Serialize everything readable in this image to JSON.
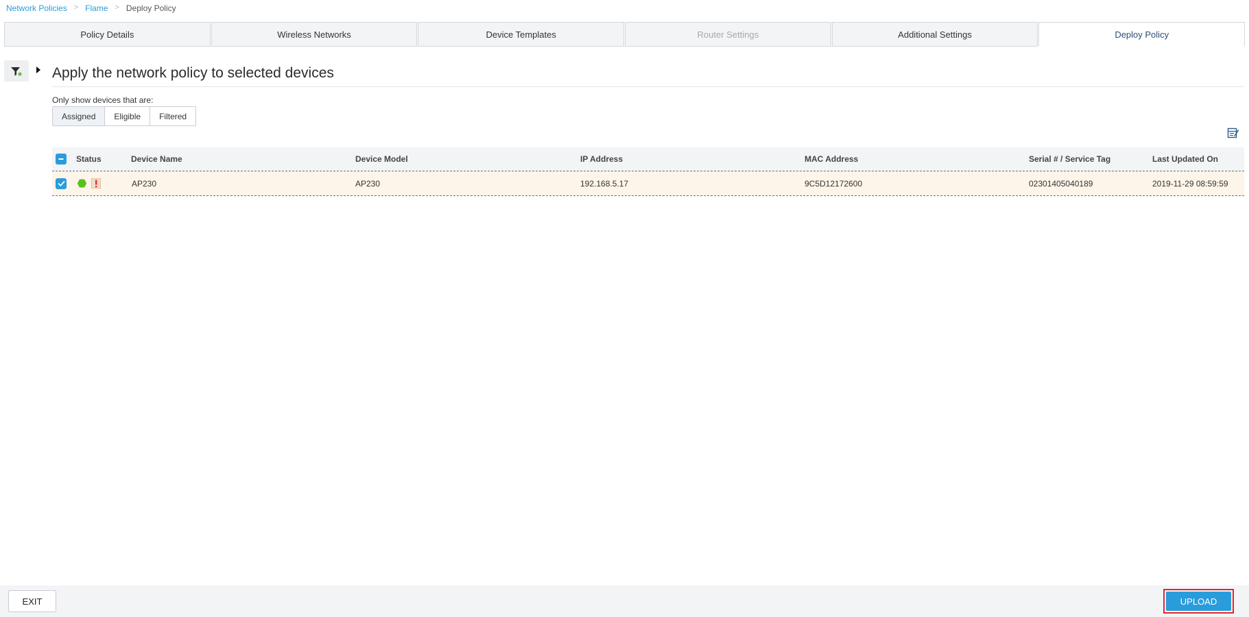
{
  "breadcrumb": {
    "items": [
      {
        "label": "Network Policies"
      },
      {
        "label": "Flame"
      },
      {
        "label": "Deploy Policy"
      }
    ],
    "separator": ">"
  },
  "tabs": [
    {
      "label": "Policy Details",
      "state": "normal"
    },
    {
      "label": "Wireless Networks",
      "state": "normal"
    },
    {
      "label": "Device Templates",
      "state": "normal"
    },
    {
      "label": "Router Settings",
      "state": "disabled"
    },
    {
      "label": "Additional Settings",
      "state": "normal"
    },
    {
      "label": "Deploy Policy",
      "state": "active"
    }
  ],
  "main": {
    "title": "Apply the network policy to selected devices",
    "filter_label": "Only show devices that are:",
    "filter_options": [
      "Assigned",
      "Eligible",
      "Filtered"
    ]
  },
  "table": {
    "columns": [
      {
        "key": "status",
        "label": "Status"
      },
      {
        "key": "device_name",
        "label": "Device Name"
      },
      {
        "key": "device_model",
        "label": "Device Model"
      },
      {
        "key": "ip_address",
        "label": "IP Address"
      },
      {
        "key": "mac_address",
        "label": "MAC Address"
      },
      {
        "key": "serial",
        "label": "Serial # / Service Tag"
      },
      {
        "key": "last_updated",
        "label": "Last Updated On"
      }
    ],
    "rows": [
      {
        "selected": true,
        "status_icons": [
          "online-hexagon-icon",
          "config-mismatch-alert-icon"
        ],
        "device_name": "AP230",
        "device_model": "AP230",
        "ip_address": "192.168.5.17",
        "mac_address": "9C5D12172600",
        "serial": "02301405040189",
        "last_updated": "2019-11-29 08:59:59"
      }
    ]
  },
  "footer": {
    "exit_label": "EXIT",
    "upload_label": "UPLOAD"
  },
  "colors": {
    "accent": "#2a9cdc",
    "active_tab_text": "#2d4e73",
    "status_online": "#55c21e",
    "alert": "#d9342b",
    "row_highlight": "#fdf5e9",
    "highlight_box": "#e8242c"
  }
}
